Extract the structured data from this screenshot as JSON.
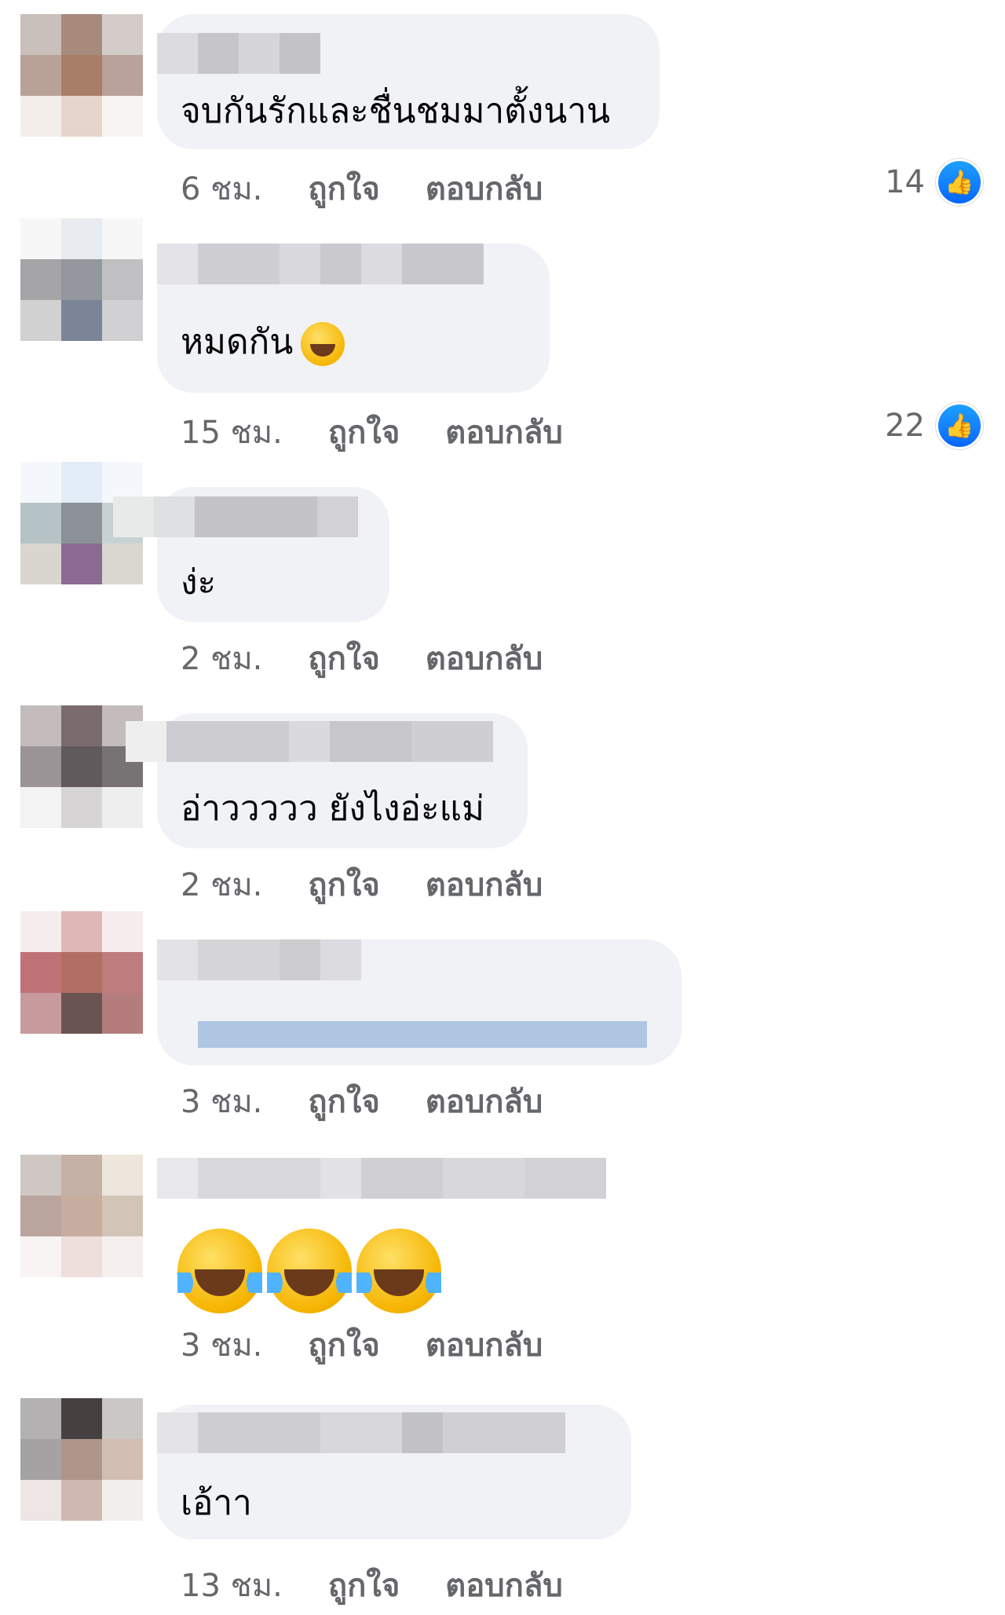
{
  "comments": [
    {
      "text": "จบกันรักและชื่นชมมาตั้งนาน",
      "time": "6 ชม.",
      "like_label": "ถูกใจ",
      "reply_label": "ตอบกลับ",
      "reaction_count": "14"
    },
    {
      "text": "หมดกัน",
      "time": "15 ชม.",
      "like_label": "ถูกใจ",
      "reply_label": "ตอบกลับ",
      "reaction_count": "22"
    },
    {
      "text": "ง่ะ",
      "time": "2 ชม.",
      "like_label": "ถูกใจ",
      "reply_label": "ตอบกลับ"
    },
    {
      "text": "อ่าววววว ยังไงอ่ะแม่",
      "time": "2 ชม.",
      "like_label": "ถูกใจ",
      "reply_label": "ตอบกลับ"
    },
    {
      "time": "3 ชม.",
      "like_label": "ถูกใจ",
      "reply_label": "ตอบกลับ"
    },
    {
      "time": "3 ชม.",
      "like_label": "ถูกใจ",
      "reply_label": "ตอบกลับ"
    },
    {
      "text": "เอ้าา",
      "time": "13 ชม.",
      "like_label": "ถูกใจ",
      "reply_label": "ตอบกลับ"
    }
  ],
  "icons": {
    "like": "thumbs-up-icon",
    "laughing": "grinning-squinting-face-icon",
    "tears_of_joy": "face-with-tears-of-joy-icon"
  },
  "colors": {
    "bubble": "#f0f2f5",
    "like_blue": "#0866ff",
    "meta_gray": "#65676b"
  }
}
